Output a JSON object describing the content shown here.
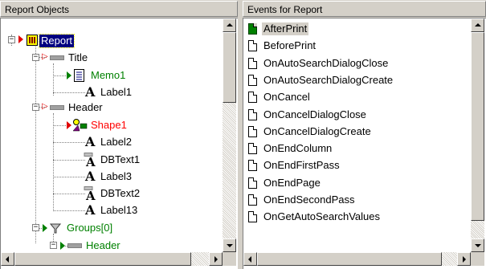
{
  "left_pane": {
    "title": "Report Objects",
    "tree": [
      {
        "label": "Report",
        "icon": "report-icon",
        "color": "black",
        "selected": true
      },
      {
        "label": "Title",
        "icon": "band-icon",
        "color": "black"
      },
      {
        "label": "Memo1",
        "icon": "memo-icon",
        "color": "green"
      },
      {
        "label": "Label1",
        "icon": "label-icon",
        "color": "black"
      },
      {
        "label": "Header",
        "icon": "band-icon",
        "color": "black"
      },
      {
        "label": "Shape1",
        "icon": "shape-icon",
        "color": "red"
      },
      {
        "label": "Label2",
        "icon": "label-icon",
        "color": "black"
      },
      {
        "label": "DBText1",
        "icon": "dbtext-icon",
        "color": "black"
      },
      {
        "label": "Label3",
        "icon": "label-icon",
        "color": "black"
      },
      {
        "label": "DBText2",
        "icon": "dbtext-icon",
        "color": "black"
      },
      {
        "label": "Label13",
        "icon": "label-icon",
        "color": "black"
      },
      {
        "label": "Groups[0]",
        "icon": "groups-icon",
        "color": "green"
      },
      {
        "label": "Header",
        "icon": "band-icon",
        "color": "green"
      }
    ]
  },
  "right_pane": {
    "title": "Events for Report",
    "events": [
      {
        "label": "AfterPrint",
        "assigned": true,
        "selected": true
      },
      {
        "label": "BeforePrint",
        "assigned": false
      },
      {
        "label": "OnAutoSearchDialogClose",
        "assigned": false
      },
      {
        "label": "OnAutoSearchDialogCreate",
        "assigned": false
      },
      {
        "label": "OnCancel",
        "assigned": false
      },
      {
        "label": "OnCancelDialogClose",
        "assigned": false
      },
      {
        "label": "OnCancelDialogCreate",
        "assigned": false
      },
      {
        "label": "OnEndColumn",
        "assigned": false
      },
      {
        "label": "OnEndFirstPass",
        "assigned": false
      },
      {
        "label": "OnEndPage",
        "assigned": false
      },
      {
        "label": "OnEndSecondPass",
        "assigned": false
      },
      {
        "label": "OnGetAutoSearchValues",
        "assigned": false
      }
    ]
  },
  "colors": {
    "face": "#d4d0c8",
    "selection": "#000080",
    "assigned_event": "#008000",
    "active_node": "#ff0000",
    "green_text": "#008000"
  }
}
